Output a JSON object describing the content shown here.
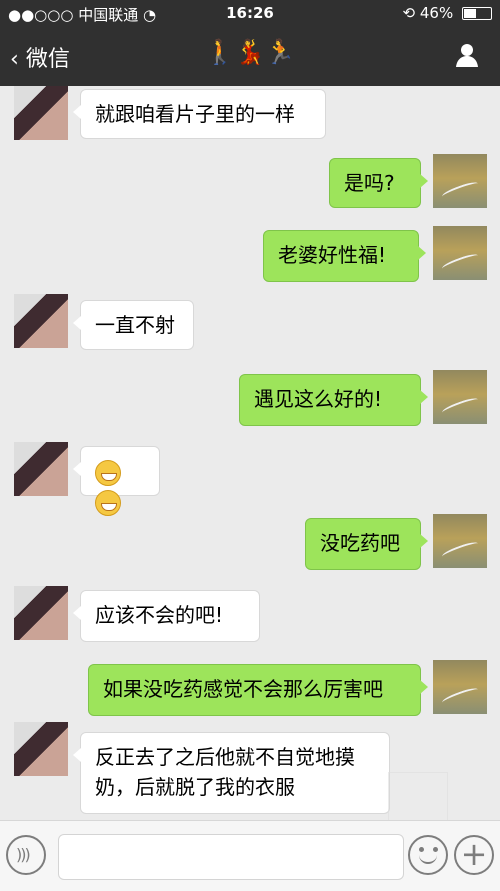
{
  "status": {
    "signal": "●●○○○",
    "carrier": "中国联通",
    "time": "16:26",
    "battery": "46%"
  },
  "nav": {
    "back_label": "微信",
    "icons": "🚶💃🏃"
  },
  "messages": [
    {
      "side": "left",
      "text": "就跟咱看片子里的一样"
    },
    {
      "side": "right",
      "text": "是吗?"
    },
    {
      "side": "right",
      "text": "老婆好性福!"
    },
    {
      "side": "left",
      "text": "一直不射"
    },
    {
      "side": "right",
      "text": "遇见这么好的!"
    },
    {
      "side": "left",
      "text": "😁😁"
    },
    {
      "side": "right",
      "text": "没吃药吧"
    },
    {
      "side": "left",
      "text": "应该不会的吧!"
    },
    {
      "side": "right",
      "text": "如果没吃药感觉不会那么厉害吧"
    },
    {
      "side": "left",
      "text": "反正去了之后他就不自觉地摸奶，后就脱了我的衣服"
    }
  ],
  "composer": {
    "placeholder": ""
  },
  "colors": {
    "nav": "#303030",
    "chat_bg": "#ebebeb",
    "right_bubble": "#9de45b"
  }
}
